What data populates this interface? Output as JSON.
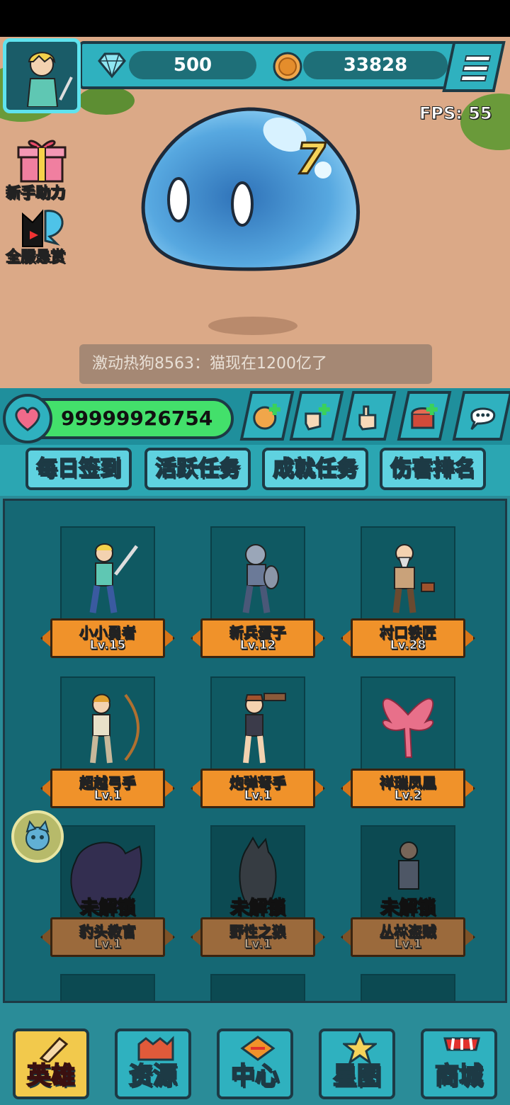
{
  "header": {
    "gems": "500",
    "coins": "33828",
    "fps_label": "FPS:",
    "fps_value": "55"
  },
  "side_buttons": [
    {
      "label": "新手助力",
      "icon": "gift-box-icon"
    },
    {
      "label": "全服悬赏",
      "icon": "bounty-cat-icon"
    }
  ],
  "boss": {
    "hit_number": "7",
    "body_color": "#3f8fcf"
  },
  "chat": {
    "message": "激动热狗8563：猫现在1200亿了"
  },
  "boss_hp": {
    "value": "99999926754"
  },
  "tabs": [
    "每日签到",
    "活跃任务",
    "成就任务",
    "伤害排名"
  ],
  "heroes": [
    {
      "name": "小小勇者",
      "level": "Lv.15",
      "locked": false
    },
    {
      "name": "新兵蛋子",
      "level": "Lv.12",
      "locked": false
    },
    {
      "name": "村口铁匠",
      "level": "Lv.28",
      "locked": false
    },
    {
      "name": "超越弓手",
      "level": "Lv.1",
      "locked": false
    },
    {
      "name": "炮弹弩手",
      "level": "Lv.1",
      "locked": false
    },
    {
      "name": "祥瑞凤凰",
      "level": "Lv.2",
      "locked": false
    },
    {
      "name": "豹头教官",
      "level": "Lv.1",
      "locked": true
    },
    {
      "name": "野性之狼",
      "level": "Lv.1",
      "locked": true
    },
    {
      "name": "丛林盗贼",
      "level": "Lv.1",
      "locked": true
    }
  ],
  "locked_label": "未解锁",
  "bottom_nav": [
    "英雄",
    "资源",
    "中心",
    "星图",
    "商城"
  ],
  "colors": {
    "accent": "#2fb1bf",
    "hp_green": "#43e06b",
    "ribbon_orange": "#f0922a",
    "active_nav": "#f2c94c"
  }
}
